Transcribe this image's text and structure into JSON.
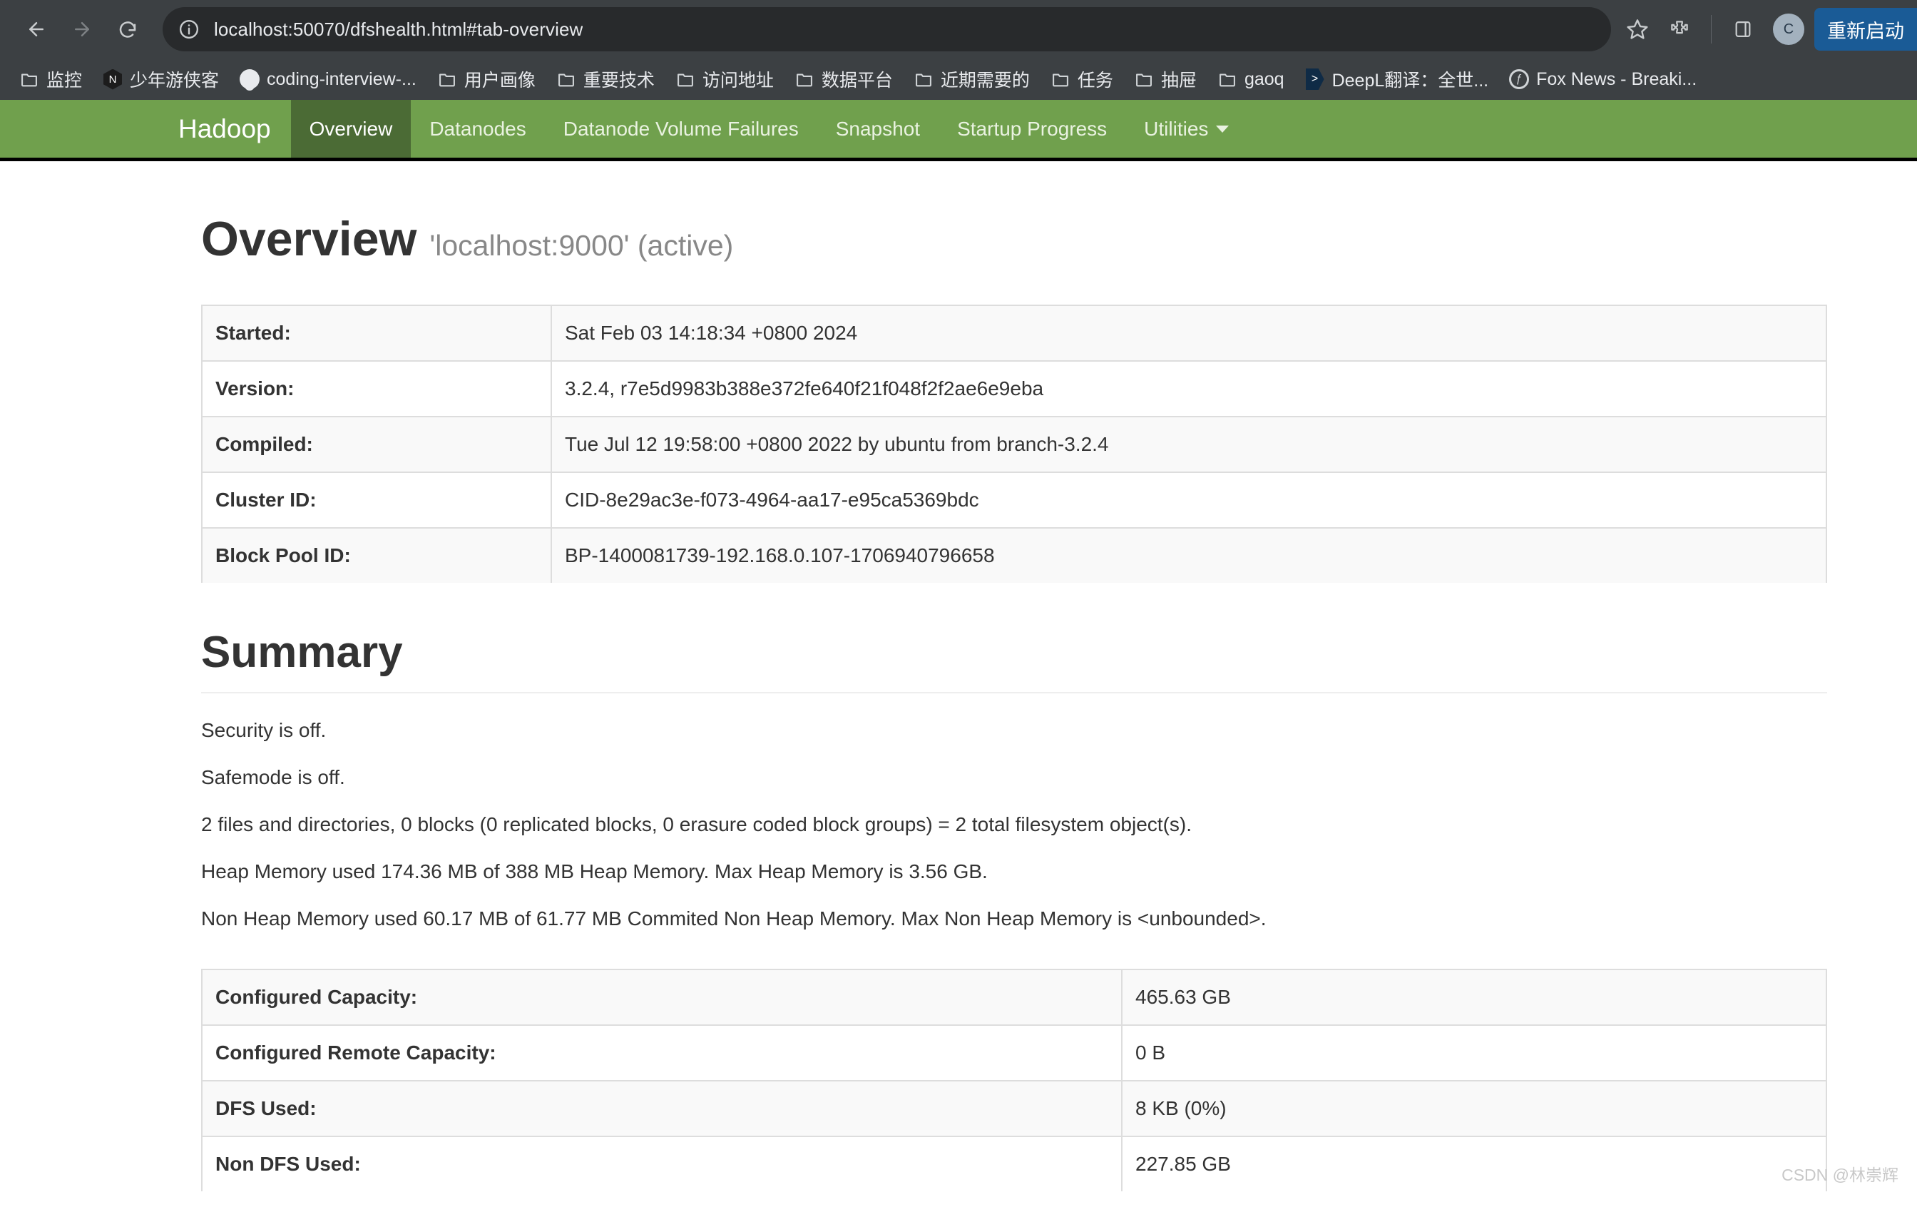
{
  "browser": {
    "url": "localhost:50070/dfshealth.html#tab-overview",
    "back_label": "Back",
    "forward_label": "Forward",
    "reload_label": "Reload",
    "site_info_label": "View site information",
    "bookmark_star_label": "Bookmark this tab",
    "extensions_label": "Extensions",
    "side_panel_label": "Side panel",
    "profile_initial": "C",
    "restart_label": "重新启动",
    "bookmarks": [
      {
        "label": "监控",
        "icon": "folder-icon"
      },
      {
        "label": "少年游侠客",
        "icon": "nuxt-hex-icon"
      },
      {
        "label": "coding-interview-...",
        "icon": "github-icon"
      },
      {
        "label": "用户画像",
        "icon": "folder-icon"
      },
      {
        "label": "重要技术",
        "icon": "folder-icon"
      },
      {
        "label": "访问地址",
        "icon": "folder-icon"
      },
      {
        "label": "数据平台",
        "icon": "folder-icon"
      },
      {
        "label": "近期需要的",
        "icon": "folder-icon"
      },
      {
        "label": "任务",
        "icon": "folder-icon"
      },
      {
        "label": "抽屉",
        "icon": "folder-icon"
      },
      {
        "label": "gaoq",
        "icon": "folder-icon"
      },
      {
        "label": "DeepL翻译：全世...",
        "icon": "deepl-icon"
      },
      {
        "label": "Fox News - Breaki...",
        "icon": "fox-news-icon"
      }
    ]
  },
  "navbar": {
    "brand": "Hadoop",
    "accent_color": "#70a04d",
    "active_color": "#4b6b35",
    "items": [
      {
        "label": "Overview",
        "active": true
      },
      {
        "label": "Datanodes",
        "active": false
      },
      {
        "label": "Datanode Volume Failures",
        "active": false
      },
      {
        "label": "Snapshot",
        "active": false
      },
      {
        "label": "Startup Progress",
        "active": false
      },
      {
        "label": "Utilities",
        "active": false,
        "dropdown": true
      }
    ]
  },
  "overview": {
    "title": "Overview",
    "subtitle": "'localhost:9000' (active)",
    "rows": [
      {
        "label": "Started:",
        "value": "Sat Feb 03 14:18:34 +0800 2024"
      },
      {
        "label": "Version:",
        "value": "3.2.4, r7e5d9983b388e372fe640f21f048f2f2ae6e9eba"
      },
      {
        "label": "Compiled:",
        "value": "Tue Jul 12 19:58:00 +0800 2022 by ubuntu from branch-3.2.4"
      },
      {
        "label": "Cluster ID:",
        "value": "CID-8e29ac3e-f073-4964-aa17-e95ca5369bdc"
      },
      {
        "label": "Block Pool ID:",
        "value": "BP-1400081739-192.168.0.107-1706940796658"
      }
    ]
  },
  "summary": {
    "title": "Summary",
    "lines": [
      "Security is off.",
      "Safemode is off.",
      "2 files and directories, 0 blocks (0 replicated blocks, 0 erasure coded block groups) = 2 total filesystem object(s).",
      "Heap Memory used 174.36 MB of 388 MB Heap Memory. Max Heap Memory is 3.56 GB.",
      "Non Heap Memory used 60.17 MB of 61.77 MB Commited Non Heap Memory. Max Non Heap Memory is <unbounded>."
    ],
    "rows": [
      {
        "label": "Configured Capacity:",
        "value": "465.63 GB"
      },
      {
        "label": "Configured Remote Capacity:",
        "value": "0 B"
      },
      {
        "label": "DFS Used:",
        "value": "8 KB (0%)"
      },
      {
        "label": "Non DFS Used:",
        "value": "227.85 GB"
      }
    ]
  },
  "watermark": "CSDN @林崇辉"
}
